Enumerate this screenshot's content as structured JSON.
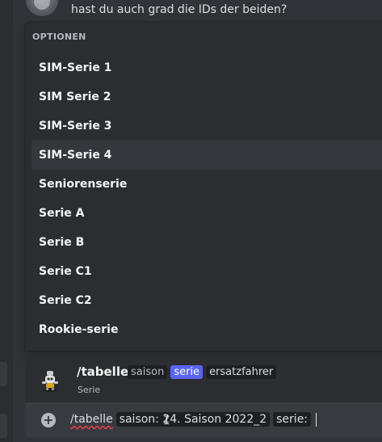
{
  "message": {
    "text": "hast du auch grad die IDs der beiden?"
  },
  "autocomplete": {
    "header": "OPTIONEN",
    "options": [
      {
        "label": "SIM-Serie 1"
      },
      {
        "label": "SIM Serie 2"
      },
      {
        "label": "SIM-Serie 3"
      },
      {
        "label": "SIM-Serie 4"
      },
      {
        "label": "Seniorenserie"
      },
      {
        "label": "Serie A"
      },
      {
        "label": "Serie B"
      },
      {
        "label": "Serie C1"
      },
      {
        "label": "Serie C2"
      },
      {
        "label": "Rookie-serie"
      }
    ],
    "selected_index": 3
  },
  "command": {
    "name": "/tabelle",
    "params": [
      "saison",
      "serie",
      "ersatzfahrer"
    ],
    "active_param": "serie",
    "description": "Serie",
    "icon": "bot-robot-icon"
  },
  "input": {
    "command": "/tabelle",
    "filled_param": "saison: 24. Saison 2022_2",
    "current_param": "serie:"
  },
  "colors": {
    "background": "#313338",
    "popup": "#2b2d31",
    "selected_row": "#35373c",
    "accent": "#5865f2",
    "input": "#383a40"
  }
}
